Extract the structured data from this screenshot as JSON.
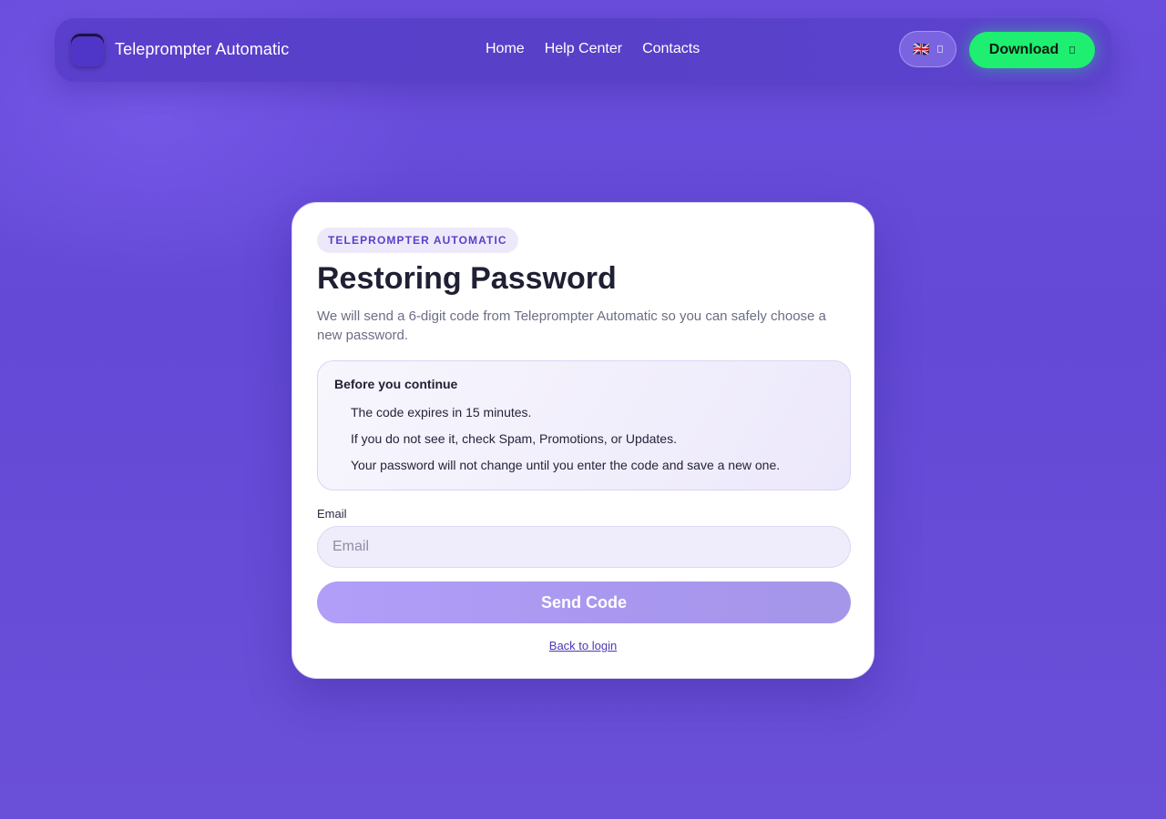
{
  "header": {
    "brand": "Teleprompter Automatic",
    "logo_icon": "app-logo-icon",
    "nav": [
      {
        "label": "Home"
      },
      {
        "label": "Help Center"
      },
      {
        "label": "Contacts"
      }
    ],
    "language": {
      "flag": "🇬🇧",
      "icon": "chevron-down-icon"
    },
    "download": {
      "label": "Download",
      "icon": "download-icon",
      "color": "#1eef70"
    }
  },
  "card": {
    "badge": "TELEPROMPTER AUTOMATIC",
    "title": "Restoring Password",
    "subtitle": "We will send a 6-digit code from Teleprompter Automatic so you can safely choose a new password.",
    "info": {
      "title": "Before you continue",
      "items": [
        "The code expires in 15 minutes.",
        "If you do not see it, check Spam, Promotions, or Updates.",
        "Your password will not change until you enter the code and save a new one."
      ]
    },
    "email": {
      "label": "Email",
      "placeholder": "Email",
      "value": ""
    },
    "send_button": "Send Code",
    "back_link": "Back to login"
  },
  "colors": {
    "background": "#6349d6",
    "accent": "#5a3fc9",
    "download": "#1eef70",
    "send_button": "#b09ef9"
  }
}
